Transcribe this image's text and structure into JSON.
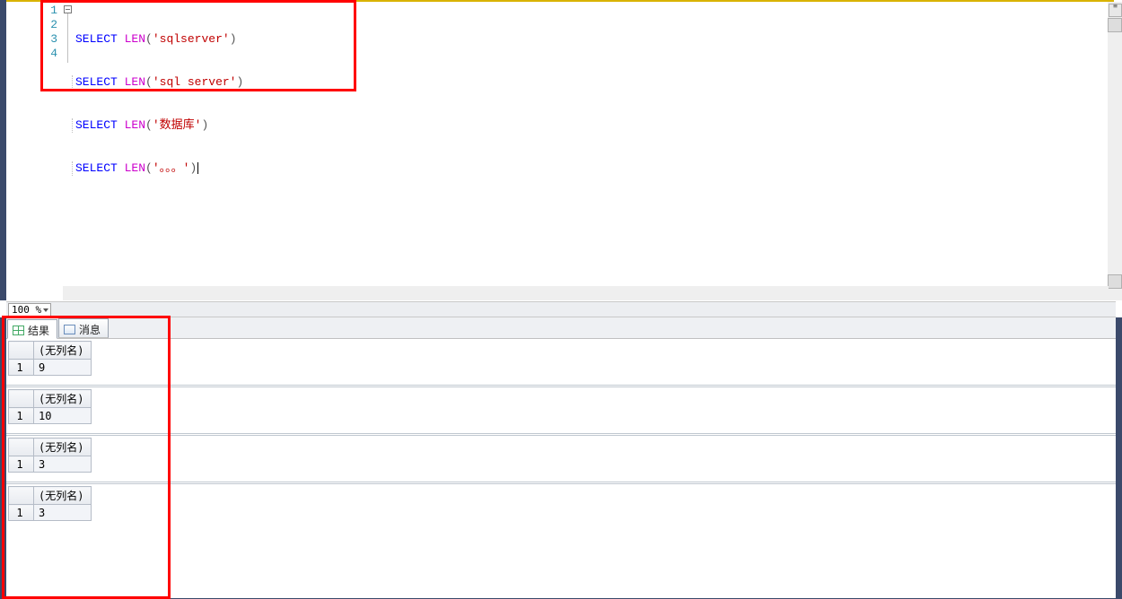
{
  "editor": {
    "lines": [
      {
        "num": "1",
        "kw": "SELECT",
        "fn": "LEN",
        "open": "(",
        "q1": "'",
        "arg": "sqlserver",
        "q2": "'",
        "close": ")"
      },
      {
        "num": "2",
        "kw": "SELECT",
        "fn": "LEN",
        "open": "(",
        "q1": "'",
        "arg": "sql server",
        "q2": "'",
        "close": ")"
      },
      {
        "num": "3",
        "kw": "SELECT",
        "fn": "LEN",
        "open": "(",
        "q1": "'",
        "arg": "数据库",
        "q2": "'",
        "close": ")"
      },
      {
        "num": "4",
        "kw": "SELECT",
        "fn": "LEN",
        "open": "(",
        "q1": "'",
        "arg": "。。。",
        "q2": "'",
        "close": ")"
      }
    ]
  },
  "zoom": {
    "value": "100 %"
  },
  "tabs": {
    "results": "结果",
    "messages": "消息"
  },
  "results": [
    {
      "header": "(无列名)",
      "row_label": "1",
      "value": "9"
    },
    {
      "header": "(无列名)",
      "row_label": "1",
      "value": "10"
    },
    {
      "header": "(无列名)",
      "row_label": "1",
      "value": "3"
    },
    {
      "header": "(无列名)",
      "row_label": "1",
      "value": "3"
    }
  ]
}
